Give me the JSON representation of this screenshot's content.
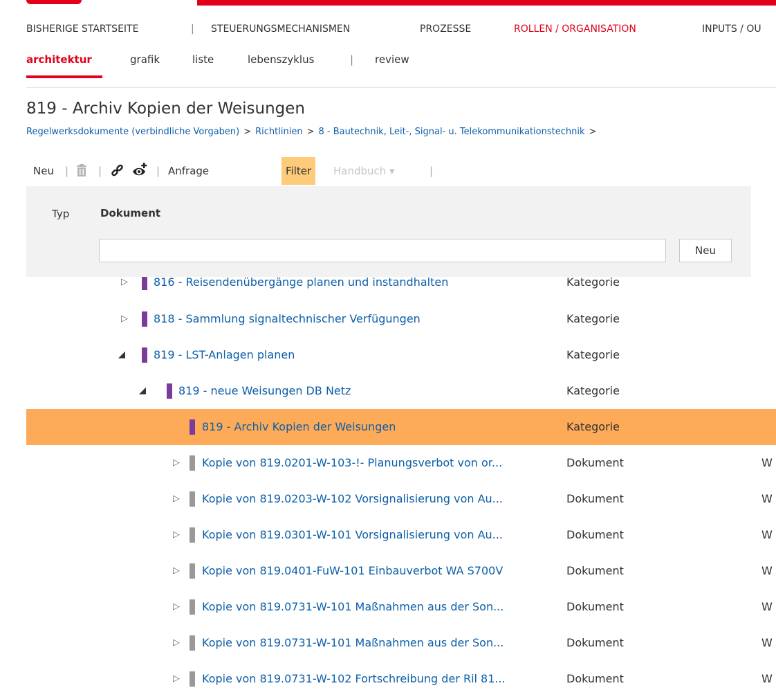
{
  "main_nav": {
    "items": [
      "BISHERIGE STARTSEITE",
      "|",
      "STEUERUNGSMECHANISMEN",
      "PROZESSE",
      "ROLLEN / ORGANISATION",
      "INPUTS / OU"
    ]
  },
  "sub_nav": {
    "items": [
      "architektur",
      "grafik",
      "liste",
      "lebenszyklus",
      "|",
      "review"
    ]
  },
  "page": {
    "title": "819 - Archiv Kopien der Weisungen",
    "breadcrumb": [
      "Regelwerksdokumente (verbindliche Vorgaben)",
      "Richtlinien",
      "8 - Bautechnik, Leit-, Signal- u. Telekommunikationstechnik"
    ],
    "breadcrumb_sep": ">"
  },
  "toolbar": {
    "neu": "Neu",
    "bar": "|",
    "trash_icon": "trash-icon",
    "link_icon": "link-icon",
    "watch_icon": "eye-plus-icon",
    "anfrage": "Anfrage",
    "filter": "Filter",
    "handbuch": "Handbuch ▾"
  },
  "filter_panel": {
    "typ_label": "Typ",
    "dokument_label": "Dokument",
    "input_value": "",
    "new_button": "Neu"
  },
  "tree": [
    {
      "name": "816 - Reisendenübergänge planen und instandhalten",
      "type": "Kategorie",
      "extra": "",
      "toggle": "▷",
      "marker": "purple"
    },
    {
      "name": "818 - Sammlung signaltechnischer Verfügungen",
      "type": "Kategorie",
      "extra": "",
      "toggle": "▷",
      "marker": "purple"
    },
    {
      "name": "819 - LST-Anlagen planen",
      "type": "Kategorie",
      "extra": "",
      "toggle": "◢",
      "marker": "purple"
    },
    {
      "name": "819 - neue Weisungen DB Netz",
      "type": "Kategorie",
      "extra": "",
      "toggle": "◢",
      "marker": "purple"
    },
    {
      "name": "819 - Archiv Kopien der Weisungen",
      "type": "Kategorie",
      "extra": "",
      "toggle": "",
      "marker": "purple"
    },
    {
      "name": "Kopie von 819.0201-W-103-!- Planungsverbot von or...",
      "type": "Dokument",
      "extra": "W",
      "toggle": "▷",
      "marker": "grey"
    },
    {
      "name": "Kopie von 819.0203-W-102 Vorsignalisierung von Au...",
      "type": "Dokument",
      "extra": "W",
      "toggle": "▷",
      "marker": "grey"
    },
    {
      "name": "Kopie von 819.0301-W-101 Vorsignalisierung von Au...",
      "type": "Dokument",
      "extra": "W",
      "toggle": "▷",
      "marker": "grey"
    },
    {
      "name": "Kopie von 819.0401-FuW-101 Einbauverbot WA S700V",
      "type": "Dokument",
      "extra": "W",
      "toggle": "▷",
      "marker": "grey"
    },
    {
      "name": "Kopie von 819.0731-W-101 Maßnahmen aus der Son...",
      "type": "Dokument",
      "extra": "W",
      "toggle": "▷",
      "marker": "grey"
    },
    {
      "name": "Kopie von 819.0731-W-101 Maßnahmen aus der Son...",
      "type": "Dokument",
      "extra": "W",
      "toggle": "▷",
      "marker": "grey"
    },
    {
      "name": "Kopie von 819.0731-W-102 Fortschreibung der Ril 81...",
      "type": "Dokument",
      "extra": "W",
      "toggle": "▷",
      "marker": "grey"
    }
  ]
}
